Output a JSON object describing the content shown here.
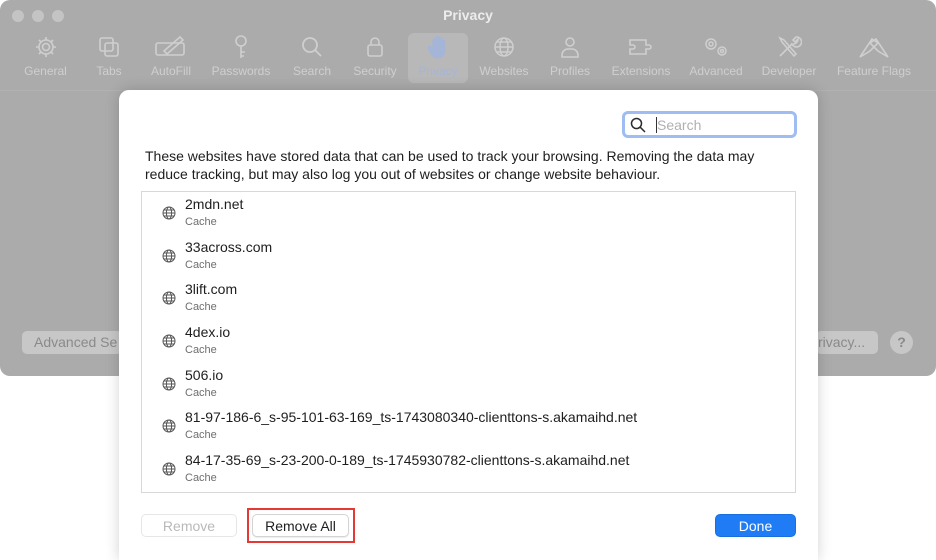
{
  "window": {
    "title": "Privacy"
  },
  "toolbar": {
    "items": [
      {
        "label": "General",
        "icon": "gear-icon"
      },
      {
        "label": "Tabs",
        "icon": "tabs-icon"
      },
      {
        "label": "AutoFill",
        "icon": "pencil-form-icon"
      },
      {
        "label": "Passwords",
        "icon": "key-icon"
      },
      {
        "label": "Search",
        "icon": "search-icon"
      },
      {
        "label": "Security",
        "icon": "lock-icon"
      },
      {
        "label": "Privacy",
        "icon": "hand-icon",
        "active": true
      },
      {
        "label": "Websites",
        "icon": "globe-icon"
      },
      {
        "label": "Profiles",
        "icon": "person-icon"
      },
      {
        "label": "Extensions",
        "icon": "puzzle-icon"
      },
      {
        "label": "Advanced",
        "icon": "gears-icon"
      },
      {
        "label": "Developer",
        "icon": "wrench-screwdriver-icon"
      },
      {
        "label": "Feature Flags",
        "icon": "flags-icon"
      }
    ]
  },
  "background": {
    "advanced_settings_label": "Advanced Se",
    "privacy_button_label": "rivacy...",
    "help_label": "?"
  },
  "sheet": {
    "search_placeholder": "Search",
    "description": "These websites have stored data that can be used to track your browsing. Removing the data may reduce tracking, but may also log you out of websites or change website behaviour.",
    "websites": [
      {
        "name": "2mdn.net",
        "type": "Cache"
      },
      {
        "name": "33across.com",
        "type": "Cache"
      },
      {
        "name": "3lift.com",
        "type": "Cache"
      },
      {
        "name": "4dex.io",
        "type": "Cache"
      },
      {
        "name": "506.io",
        "type": "Cache"
      },
      {
        "name": "81-97-186-6_s-95-101-63-169_ts-1743080340-clienttons-s.akamaihd.net",
        "type": "Cache"
      },
      {
        "name": "84-17-35-69_s-23-200-0-189_ts-1745930782-clienttons-s.akamaihd.net",
        "type": "Cache"
      }
    ],
    "remove_label": "Remove",
    "remove_all_label": "Remove All",
    "done_label": "Done"
  },
  "colors": {
    "accent": "#1f7cf5",
    "highlight": "#e53935",
    "search_focus": "#9fbdf2"
  }
}
